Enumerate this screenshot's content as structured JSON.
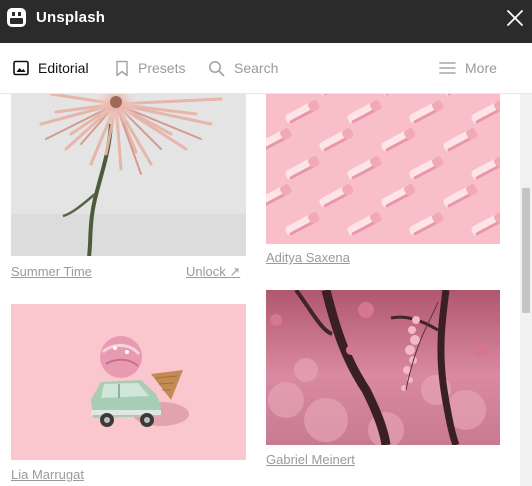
{
  "window": {
    "title": "Unsplash"
  },
  "toolbar": {
    "editorial_label": "Editorial",
    "presets_label": "Presets",
    "search_label": "Search",
    "more_label": "More"
  },
  "photos": [
    {
      "caption": "Summer Time",
      "action_label": "Unlock ↗"
    },
    {
      "caption": "Aditya Saxena"
    },
    {
      "caption": "Lia Marrugat"
    },
    {
      "caption": "Gabriel Meinert"
    }
  ],
  "colors": {
    "titlebar": "#2b2b2b",
    "active_text": "#111111",
    "inactive_text": "#9a9a9a",
    "pink_background": "#fbc7cf"
  }
}
